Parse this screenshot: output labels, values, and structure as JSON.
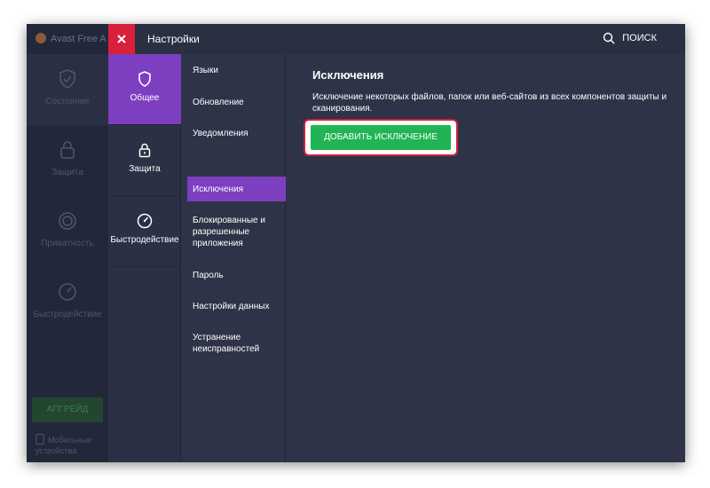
{
  "app": {
    "bg_title": "Avast Free A",
    "bg_nav": [
      "Состояние",
      "Защита",
      "Приватность",
      "Быстродействие"
    ],
    "bg_upgrade_label": "АПГРЕЙД",
    "bg_mobile_label": "Мобильные устройства"
  },
  "header": {
    "title": "Настройки",
    "search_label": "ПОИСК"
  },
  "categories": [
    {
      "label": "Общее",
      "icon": "shield-icon",
      "active": true
    },
    {
      "label": "Защита",
      "icon": "lock-icon",
      "active": false
    },
    {
      "label": "Быстродействие",
      "icon": "speedometer-icon",
      "active": false
    }
  ],
  "subnav": [
    {
      "label": "Языки"
    },
    {
      "label": "Обновление"
    },
    {
      "label": "Уведомления"
    },
    {
      "label": "Исключения",
      "active": true
    },
    {
      "label": "Блокированные и разрешенные приложения"
    },
    {
      "label": "Пароль"
    },
    {
      "label": "Настройки данных"
    },
    {
      "label": "Устранение неисправностей"
    }
  ],
  "content": {
    "title": "Исключения",
    "description": "Исключение некоторых файлов, папок или веб-сайтов из всех компонентов защиты и сканирования.",
    "add_button_label": "ДОБАВИТЬ ИСКЛЮЧЕНИЕ"
  },
  "colors": {
    "accent_purple": "#7d3ec0",
    "close_red": "#d9203b",
    "button_green": "#21b454",
    "highlight_red": "#d2203a",
    "panel_bg": "#2e3347"
  }
}
